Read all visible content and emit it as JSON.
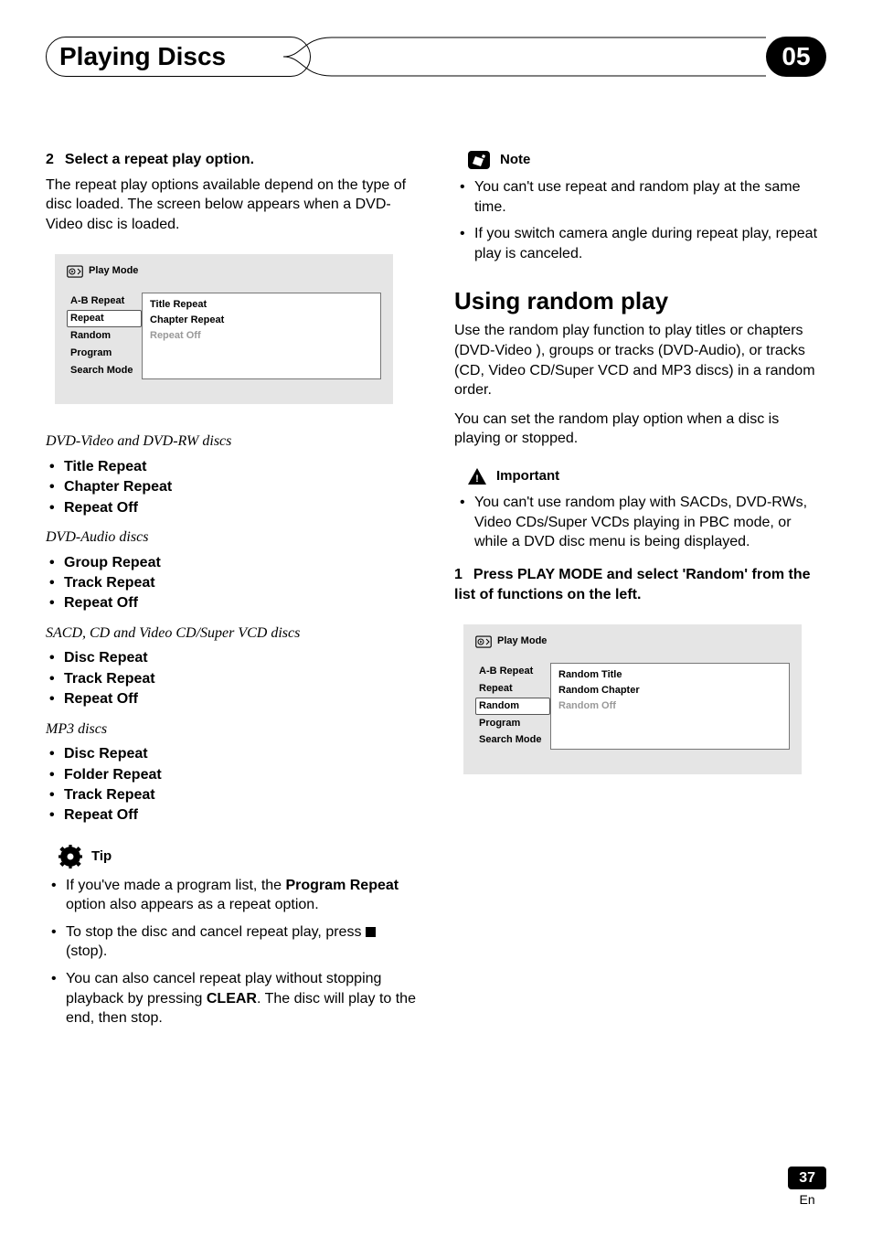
{
  "header": {
    "chapter_title": "Playing Discs",
    "chapter_number": "05"
  },
  "left": {
    "step2_num": "2",
    "step2_title": "Select a repeat play option.",
    "step2_body": "The repeat play options available depend on the type of disc loaded. The screen below appears when a DVD-Video disc is loaded.",
    "menu1": {
      "title": "Play Mode",
      "left_items": [
        "A-B Repeat",
        "Repeat",
        "Random",
        "Program",
        "Search Mode"
      ],
      "selected_index": 1,
      "right_items": [
        "Title Repeat",
        "Chapter Repeat",
        "Repeat Off"
      ],
      "dimmed_index": 2
    },
    "groups": [
      {
        "heading": "DVD-Video and DVD-RW discs",
        "items": [
          "Title Repeat",
          "Chapter Repeat",
          "Repeat Off"
        ]
      },
      {
        "heading": "DVD-Audio discs",
        "items": [
          "Group Repeat",
          "Track Repeat",
          "Repeat Off"
        ]
      },
      {
        "heading": "SACD, CD and Video CD/Super VCD discs",
        "items": [
          "Disc Repeat",
          "Track Repeat",
          "Repeat Off"
        ]
      },
      {
        "heading": "MP3 discs",
        "items": [
          "Disc Repeat",
          "Folder Repeat",
          "Track Repeat",
          "Repeat Off"
        ]
      }
    ],
    "tip_label": "Tip",
    "tips": {
      "t1a": "If you've made a program list, the ",
      "t1b": "Program Repeat",
      "t1c": " option also appears as a repeat option.",
      "t2a": "To stop the disc and cancel repeat play, press ",
      "t2b": " (stop).",
      "t3a": "You can also cancel repeat play without stopping playback by pressing ",
      "t3b": "CLEAR",
      "t3c": ". The disc will play to the end, then stop."
    }
  },
  "right": {
    "note_label": "Note",
    "notes": [
      "You can't use repeat and random play at the same time.",
      "If you switch camera angle during repeat play, repeat play is canceled."
    ],
    "section_title": "Using random play",
    "body1": "Use the random play function to play titles or chapters (DVD-Video ), groups or tracks (DVD-Audio), or tracks (CD, Video CD/Super VCD and MP3 discs) in a random order.",
    "body2": "You can set the random play option when a disc is playing or stopped.",
    "important_label": "Important",
    "important_note": "You can't use random play with SACDs, DVD-RWs, Video CDs/Super VCDs playing in PBC mode, or while  a DVD disc menu is being displayed.",
    "step1_num": "1",
    "step1_title": "Press PLAY MODE and select 'Random' from the list of functions on the left.",
    "menu2": {
      "title": "Play Mode",
      "left_items": [
        "A-B Repeat",
        "Repeat",
        "Random",
        "Program",
        "Search Mode"
      ],
      "selected_index": 2,
      "right_items": [
        "Random Title",
        "Random Chapter",
        "Random Off"
      ],
      "dimmed_index": 2
    }
  },
  "footer": {
    "page": "37",
    "lang": "En"
  }
}
